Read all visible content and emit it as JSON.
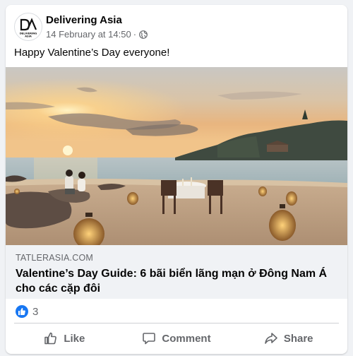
{
  "post": {
    "page_name": "Delivering Asia",
    "avatar_logo": {
      "mark": "DA",
      "caption": "DELIVERING ASIA"
    },
    "timestamp": "14 February at 14:50",
    "separator": "·",
    "audience_icon": "globe-icon",
    "message": "Happy Valentine’s Day everyone!"
  },
  "link_preview": {
    "domain": "TATLERASIA.COM",
    "title": "Valentine’s Day Guide: 6 bãi biển lãng mạn ở Đông Nam Á cho các cặp đôi"
  },
  "reactions": {
    "icon": "like-reaction-icon",
    "count": "3"
  },
  "actions": {
    "like_label": "Like",
    "comment_label": "Comment",
    "share_label": "Share"
  },
  "colors": {
    "facebook_blue": "#1877f2",
    "secondary_text": "#65676b",
    "link_preview_bg": "#f0f2f5"
  }
}
